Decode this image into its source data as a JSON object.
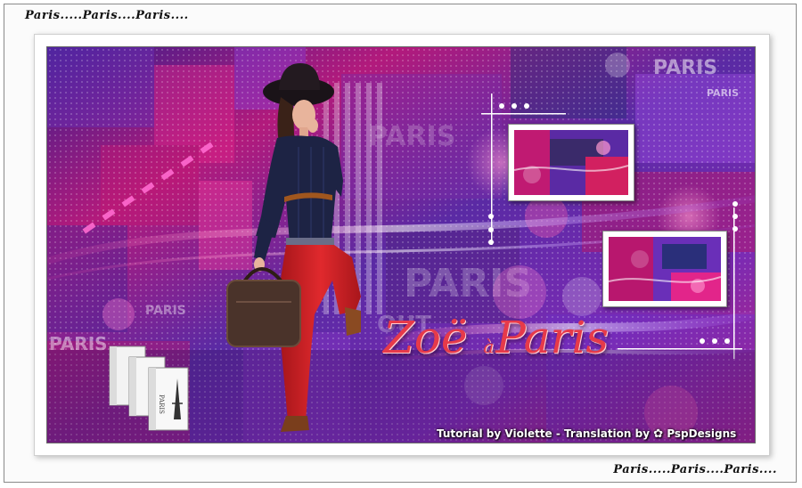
{
  "captions": {
    "top": "Paris.....Paris....Paris....",
    "bottom": "Paris.....Paris....Paris...."
  },
  "artwork": {
    "title_main": "Zoë",
    "title_small": "à",
    "title_end": "Paris",
    "credit": "Tutorial by Violette - Translation by",
    "credit_brand": "PspDesigns",
    "background_words": [
      "PARIS",
      "PARIS",
      "PARIS",
      "PARIS",
      "OUT",
      "PARIS",
      "PARIS"
    ],
    "book_label": "PARIS"
  },
  "colors": {
    "magenta": "#d4197a",
    "purple": "#5b2ba8",
    "violet": "#8a3fd0",
    "title_red": "#e63a4a",
    "jeans_red": "#d81f24",
    "sweater_navy": "#1d2344"
  }
}
